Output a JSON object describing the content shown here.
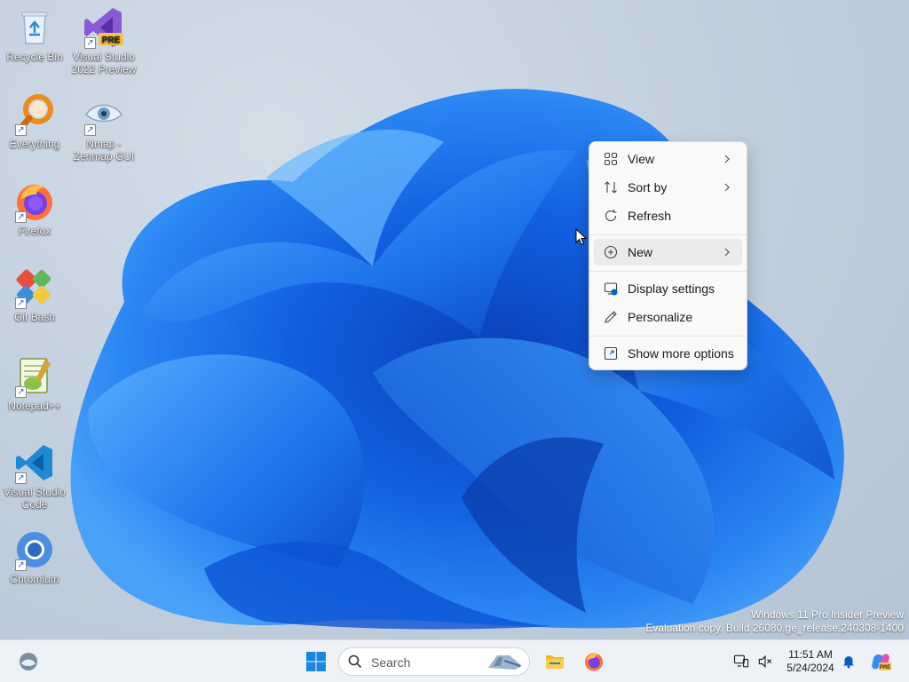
{
  "desktop": {
    "icons": [
      {
        "label": "Recycle Bin",
        "icon": "recycle-bin-icon",
        "shortcut": false
      },
      {
        "label": "Visual Studio 2022 Preview",
        "icon": "visual-studio-preview-icon",
        "badge": "PRE",
        "shortcut": true
      },
      {
        "label": "Everything",
        "icon": "everything-search-icon",
        "shortcut": true
      },
      {
        "label": "Nmap - Zenmap GUI",
        "icon": "nmap-eye-icon",
        "shortcut": true
      },
      {
        "label": "Firefox",
        "icon": "firefox-icon",
        "shortcut": true
      },
      {
        "label": "Git Bash",
        "icon": "git-bash-icon",
        "shortcut": true
      },
      {
        "label": "Notepad++",
        "icon": "notepad-plus-plus-icon",
        "shortcut": true
      },
      {
        "label": "Visual Studio Code",
        "icon": "vscode-icon",
        "shortcut": true
      },
      {
        "label": "Chromium",
        "icon": "chromium-icon",
        "shortcut": true
      }
    ]
  },
  "context_menu": {
    "items": [
      {
        "label": "View",
        "icon": "grid-view-icon",
        "submenu": true
      },
      {
        "label": "Sort by",
        "icon": "sort-arrows-icon",
        "submenu": true
      },
      {
        "label": "Refresh",
        "icon": "refresh-icon",
        "submenu": false
      },
      {
        "label": "New",
        "icon": "plus-circle-icon",
        "submenu": true,
        "highlighted": true
      },
      {
        "label": "Display settings",
        "icon": "display-settings-icon",
        "submenu": false
      },
      {
        "label": "Personalize",
        "icon": "pen-icon",
        "submenu": false
      },
      {
        "label": "Show more options",
        "icon": "external-options-icon",
        "submenu": false
      }
    ]
  },
  "watermark": {
    "line1": "Windows 11 Pro Insider Preview",
    "line2": "Evaluation copy. Build 26080.ge_release.240308-1400"
  },
  "taskbar": {
    "search_placeholder": "Search",
    "pinned": [
      "widgets-icon",
      "start-windows-icon",
      "file-explorer-icon",
      "firefox-icon"
    ],
    "tray_icons": [
      "network-monitor-icon",
      "volume-muted-icon",
      "notification-bell-icon",
      "copilot-icon"
    ],
    "time": "11:51 AM",
    "date": "5/24/2024",
    "copilot_badge": "PRE"
  },
  "colors": {
    "accent": "#0067c0",
    "wallpaper_blue": "#1a6fe8",
    "menu_bg": "#f9f9f9",
    "taskbar_bg": "#eef1f6"
  }
}
